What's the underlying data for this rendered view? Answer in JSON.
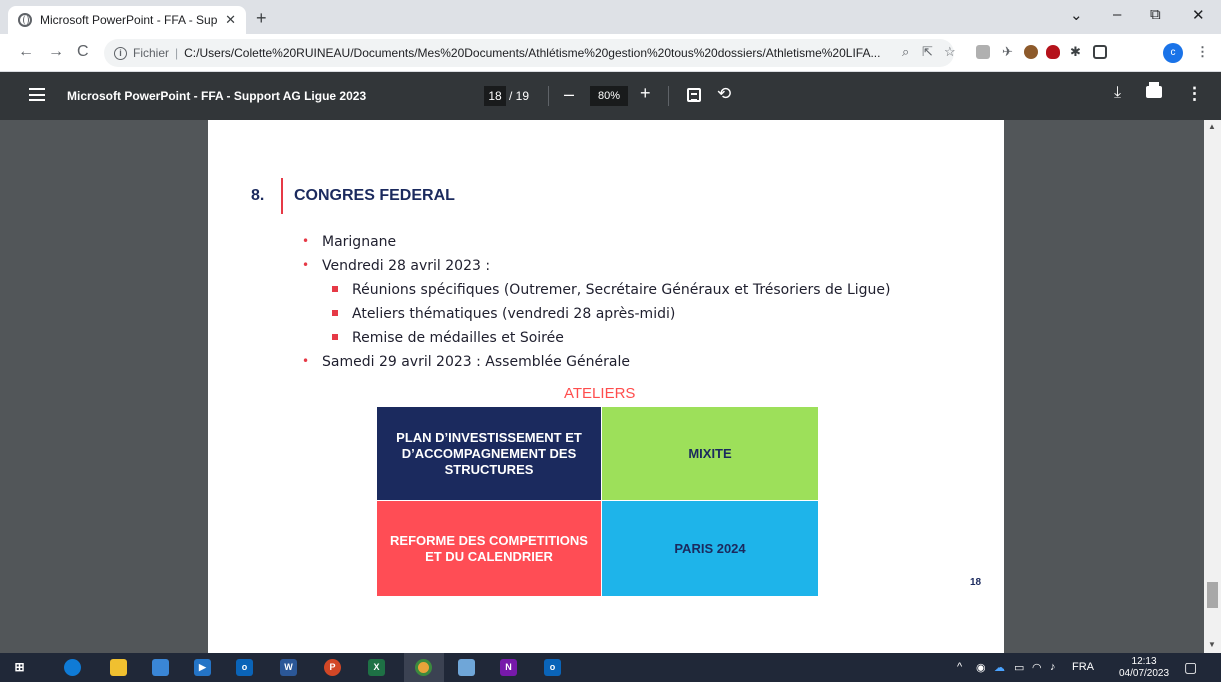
{
  "browser": {
    "tab_title": "Microsoft PowerPoint - FFA - Sup",
    "tab_close": "✕",
    "new_tab": "+",
    "window_controls": {
      "minimize": "–",
      "restore": "⧉",
      "close": "✕",
      "menu": "⌄"
    },
    "omnibox": {
      "scheme_label": "Fichier",
      "separator": "|",
      "url": "C:/Users/Colette%20RUINEAU/Documents/Mes%20Documents/Athlétisme%20gestion%20tous%20dossiers/Athletisme%20LIFA..."
    },
    "profile_initial": "c"
  },
  "pdf_toolbar": {
    "title": "Microsoft PowerPoint - FFA - Support AG Ligue 2023",
    "current_page": "18",
    "total_pages": "/ 19",
    "zoom": "80%",
    "zoom_out": "–",
    "zoom_in": "+"
  },
  "slide": {
    "section_number": "8.",
    "section_title": "CONGRES FEDERAL",
    "bullets": [
      {
        "level": 1,
        "text": "Marignane"
      },
      {
        "level": 1,
        "text": "Vendredi 28 avril 2023 :"
      },
      {
        "level": 2,
        "text": "Réunions  spécifiques (Outremer, Secrétaire Généraux et Trésoriers de Ligue)"
      },
      {
        "level": 2,
        "text": "Ateliers thématiques (vendredi 28 après-midi)"
      },
      {
        "level": 2,
        "text": "Remise de médailles et Soirée"
      },
      {
        "level": 1,
        "text": "Samedi 29 avril 2023 : Assemblée Générale"
      }
    ],
    "ateliers_title": "ATELIERS",
    "grid": [
      {
        "text": "PLAN D’INVESTISSEMENT ET D’ACCOMPAGNEMENT DES STRUCTURES",
        "bg": "#1b2a5e",
        "color": "#ffffff"
      },
      {
        "text": "MIXITE",
        "bg": "#9de05a",
        "color": "#1b2a5e"
      },
      {
        "text": "REFORME DES COMPETITIONS ET DU CALENDRIER",
        "bg": "#ff4d55",
        "color": "#ffffff"
      },
      {
        "text": "PARIS 2024",
        "bg": "#1eb4ea",
        "color": "#1b2a5e"
      }
    ],
    "page_number": "18",
    "colors": {
      "accent": "#e63946",
      "navy": "#1b2a5e"
    }
  },
  "taskbar": {
    "apps": [
      "windows-start",
      "edge",
      "file-explorer",
      "store",
      "media",
      "outlook",
      "word",
      "powerpoint",
      "excel",
      "chrome",
      "photos",
      "onenote",
      "outlook-new"
    ],
    "tray_lang": "FRA",
    "time": "12:13",
    "date": "04/07/2023"
  }
}
